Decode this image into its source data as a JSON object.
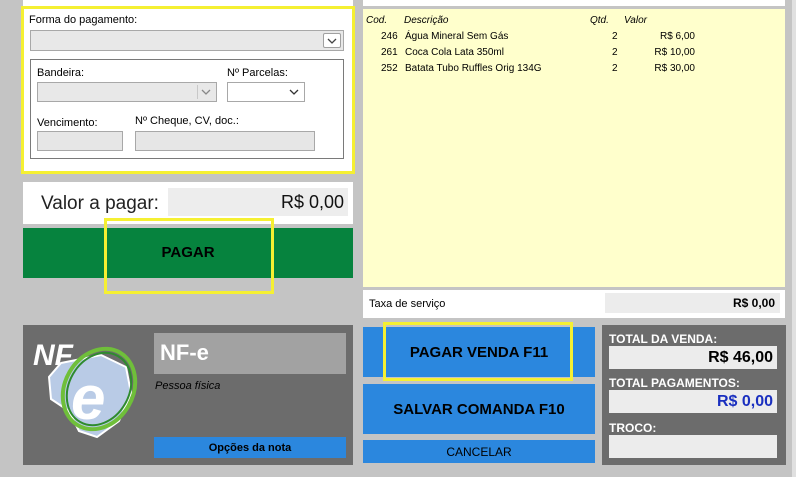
{
  "payment_form": {
    "forma_label": "Forma do pagamento:",
    "bandeira_label": "Bandeira:",
    "parcelas_label": "Nº Parcelas:",
    "vencimento_label": "Vencimento:",
    "cheque_label": "Nº Cheque, CV, doc.:"
  },
  "valor": {
    "label": "Valor a pagar:",
    "amount": "R$ 0,00"
  },
  "pagar_button": "PAGAR",
  "items": {
    "headers": [
      "Cod.",
      "Descrição",
      "Qtd.",
      "Valor"
    ],
    "rows": [
      {
        "cod": "246",
        "desc": "Água Mineral Sem Gás",
        "qtd": "2",
        "valor": "R$ 6,00"
      },
      {
        "cod": "261",
        "desc": "Coca Cola Lata 350ml",
        "qtd": "2",
        "valor": "R$ 10,00"
      },
      {
        "cod": "252",
        "desc": "Batata Tubo Ruffles Orig 134G",
        "qtd": "2",
        "valor": "R$ 30,00"
      }
    ]
  },
  "taxa": {
    "label": "Taxa de serviço",
    "amount": "R$ 0,00"
  },
  "nfe": {
    "title": "NF-e",
    "subtitle": "Pessoa física",
    "options_button": "Opções da nota",
    "logo_text_nf": "NF",
    "logo_text_e": "e"
  },
  "actions": {
    "pagar_venda": "PAGAR VENDA F11",
    "salvar_comanda": "SALVAR COMANDA F10",
    "cancelar": "CANCELAR"
  },
  "totals": {
    "total_venda_label": "TOTAL DA VENDA:",
    "total_venda": "R$ 46,00",
    "total_pagamentos_label": "TOTAL PAGAMENTOS:",
    "total_pagamentos": "R$ 0,00",
    "troco_label": "TROCO:",
    "troco": ""
  },
  "colors": {
    "highlight": "#f5f032",
    "green": "#06833e",
    "blue": "#2b87de",
    "panel_gray": "#6c6c6c",
    "list_bg": "#ffffcc"
  }
}
